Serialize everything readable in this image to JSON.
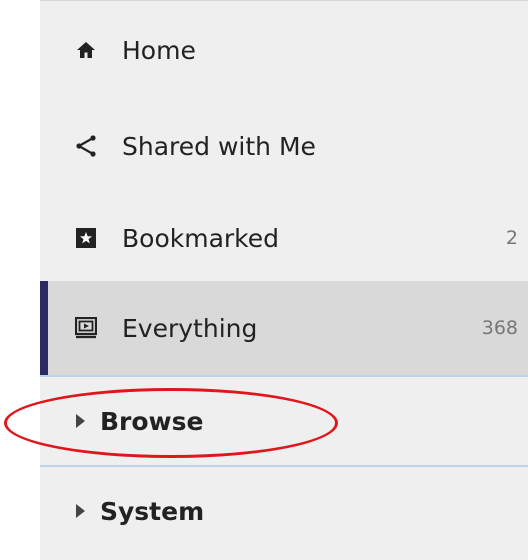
{
  "nav": {
    "items": [
      {
        "label": "Home",
        "icon": "home-icon"
      },
      {
        "label": "Shared with Me",
        "icon": "share-icon"
      },
      {
        "label": "Bookmarked",
        "icon": "bookmark-icon",
        "count": "2"
      },
      {
        "label": "Everything",
        "icon": "everything-icon",
        "count": "368",
        "active": true
      }
    ]
  },
  "sections": [
    {
      "title": "Browse",
      "icon": "caret-right-icon"
    },
    {
      "title": "System",
      "icon": "caret-right-icon"
    }
  ],
  "colors": {
    "panel_bg": "#efefef",
    "active_bg": "#d9d9d9",
    "active_bar": "#2c2a63",
    "separator": "#bcd3ea",
    "annotation": "#e0161b"
  }
}
